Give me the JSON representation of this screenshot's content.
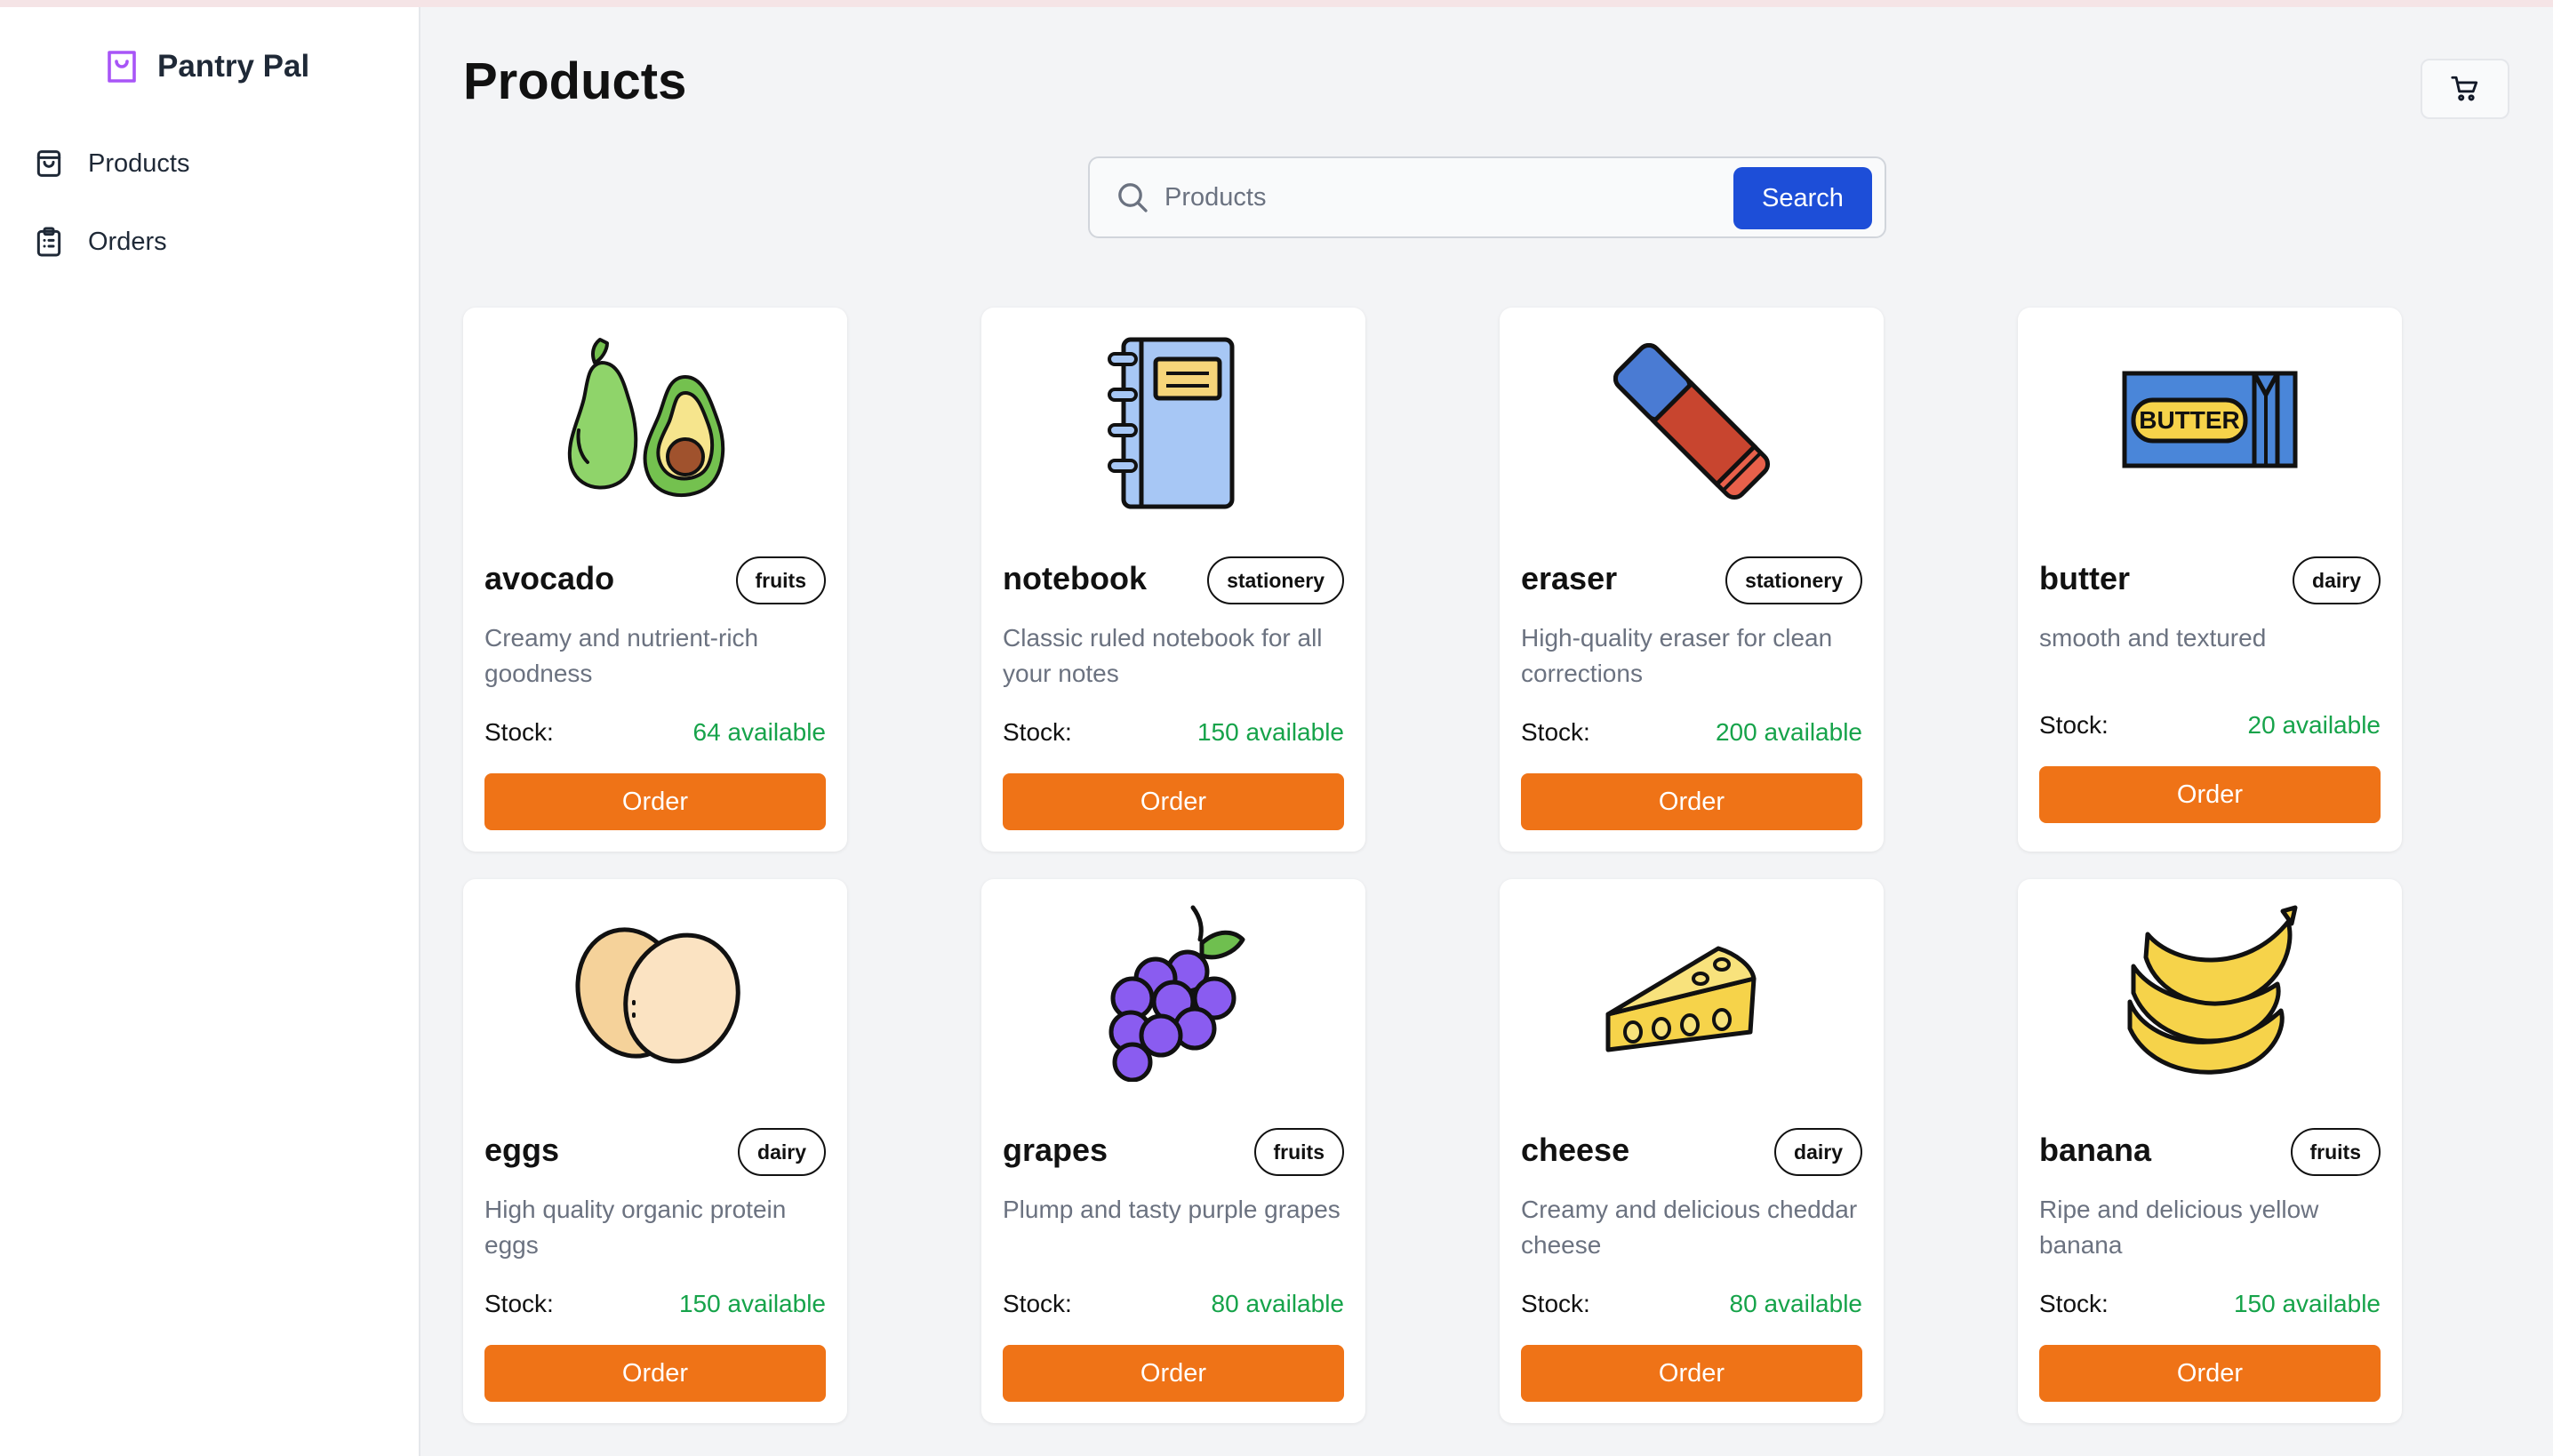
{
  "app": {
    "name": "Pantry Pal"
  },
  "sidebar": {
    "items": [
      {
        "label": "Products",
        "icon": "shopping-bag-icon"
      },
      {
        "label": "Orders",
        "icon": "clipboard-list-icon"
      }
    ]
  },
  "header": {
    "title": "Products"
  },
  "search": {
    "placeholder": "Products",
    "value": "",
    "button_label": "Search"
  },
  "stock_label": "Stock:",
  "order_label": "Order",
  "colors": {
    "accent": "#1d4ed8",
    "order": "#ef7317",
    "stock": "#16a34a",
    "brand": "#a855f7"
  },
  "products": [
    {
      "name": "avocado",
      "category": "fruits",
      "description": "Creamy and nutrient-rich goodness",
      "stock": "64 available",
      "icon": "avocado-icon"
    },
    {
      "name": "notebook",
      "category": "stationery",
      "description": "Classic ruled notebook for all your notes",
      "stock": "150 available",
      "icon": "notebook-icon"
    },
    {
      "name": "eraser",
      "category": "stationery",
      "description": "High-quality eraser for clean corrections",
      "stock": "200 available",
      "icon": "eraser-icon"
    },
    {
      "name": "butter",
      "category": "dairy",
      "description": "smooth and textured",
      "stock": "20 available",
      "icon": "butter-icon",
      "label_text": "BUTTER"
    },
    {
      "name": "eggs",
      "category": "dairy",
      "description": "High quality organic protein eggs",
      "stock": "150 available",
      "icon": "eggs-icon"
    },
    {
      "name": "grapes",
      "category": "fruits",
      "description": "Plump and tasty purple grapes",
      "stock": "80 available",
      "icon": "grapes-icon"
    },
    {
      "name": "cheese",
      "category": "dairy",
      "description": "Creamy and delicious cheddar cheese",
      "stock": "80 available",
      "icon": "cheese-icon"
    },
    {
      "name": "banana",
      "category": "fruits",
      "description": "Ripe and delicious yellow banana",
      "stock": "150 available",
      "icon": "banana-icon"
    }
  ]
}
